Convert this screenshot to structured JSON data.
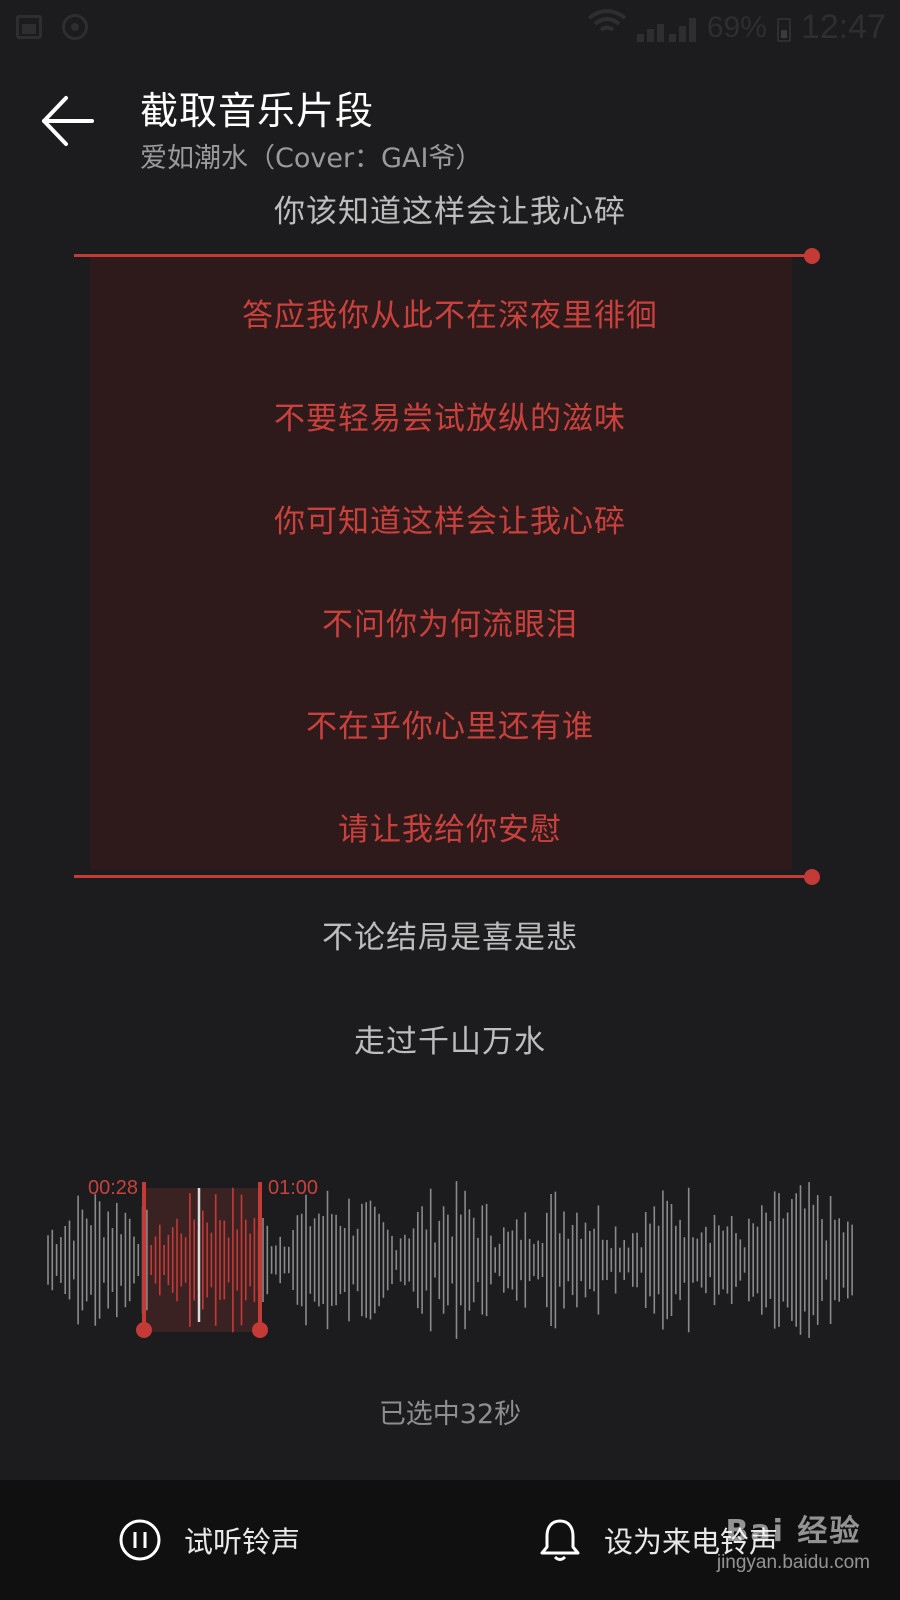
{
  "status_bar": {
    "battery_percent": "69%",
    "time": "12:47"
  },
  "header": {
    "title": "截取音乐片段",
    "subtitle": "爱如潮水（Cover：GAI爷）"
  },
  "lyrics": {
    "before": "你该知道这样会让我心碎",
    "selected": [
      "答应我你从此不在深夜里徘徊",
      "不要轻易尝试放纵的滋味",
      "你可知道这样会让我心碎",
      "不问你为何流眼泪",
      "不在乎你心里还有谁",
      "请让我给你安慰"
    ],
    "after": [
      "不论结局是喜是悲",
      "走过千山万水"
    ]
  },
  "clip": {
    "start_time": "00:28",
    "end_time": "01:00",
    "selected_text": "已选中32秒"
  },
  "actions": {
    "preview_label": "试听铃声",
    "set_ringtone_label": "设为来电铃声"
  },
  "watermark": {
    "line1": "Bai 经验",
    "line2": "jingyan.baidu.com"
  },
  "colors": {
    "accent": "#c43a36",
    "background": "#1c1c1e",
    "bottom_bar": "#101011"
  }
}
